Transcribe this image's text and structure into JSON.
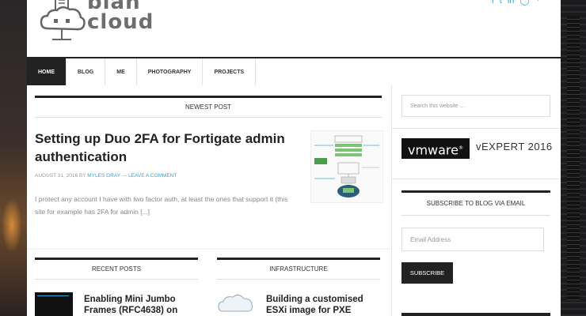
{
  "brand": {
    "line1": "blah",
    "line2": "cloud"
  },
  "social_icons": [
    "facebook-icon",
    "twitter-icon",
    "linkedin-icon",
    "github-icon",
    "feed-icon"
  ],
  "nav": {
    "items": [
      {
        "label": "HOME",
        "active": true
      },
      {
        "label": "BLOG",
        "active": false
      },
      {
        "label": "ME",
        "active": false
      },
      {
        "label": "PHOTOGRAPHY",
        "active": false
      },
      {
        "label": "PROJECTS",
        "active": false
      }
    ]
  },
  "main": {
    "newest_heading": "NEWEST POST",
    "post": {
      "title": "Setting up Duo 2FA for Fortigate admin authentication",
      "date": "AUGUST 31, 2016",
      "by": "BY",
      "author": "MYLES GRAY",
      "dash": "—",
      "comment_link": "LEAVE A COMMENT",
      "excerpt": "I protect any account I have with two factor auth, at least the ones that support it (this site for example has 2FA for admin [...]"
    },
    "recent_heading": "RECENT POSTS",
    "recent_title": "Enabling Mini Jumbo Frames (RFC4638) on",
    "infra_heading": "INFRASTRUCTURE",
    "infra_title": "Building a customised ESXi image for PXE"
  },
  "sidebar": {
    "search_placeholder": "Search this website ...",
    "vmware_logo": "vmware",
    "vexpert": "vEXPERT 2016",
    "subscribe_heading": "SUBSCRIBE TO BLOG VIA EMAIL",
    "email_placeholder": "Email Address",
    "subscribe_button": "SUBSCRIBE"
  },
  "colors": {
    "accent": "#3aa3d4",
    "dark": "#222222"
  }
}
